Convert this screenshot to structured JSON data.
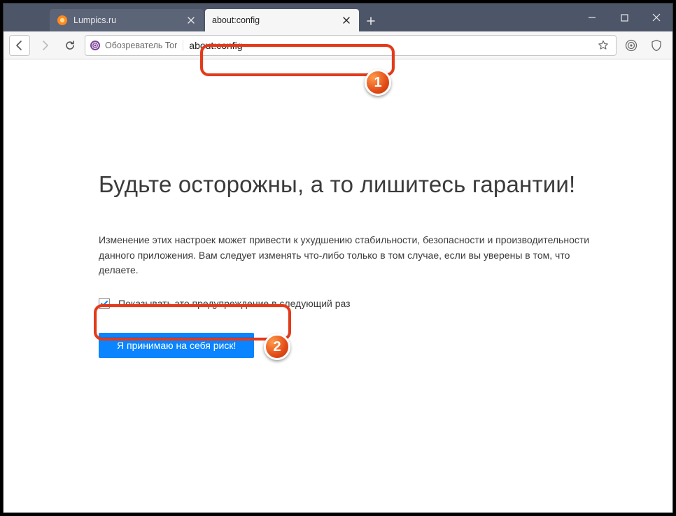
{
  "tabs": [
    {
      "title": "Lumpics.ru",
      "active": false
    },
    {
      "title": "about:config",
      "active": true
    }
  ],
  "identity_label": "Обозреватель Tor",
  "address_value": "about:config",
  "page": {
    "title": "Будьте осторожны, а то лишитесь гарантии!",
    "description": "Изменение этих настроек может привести к ухудшению стабильности, безопасности и производительности данного приложения. Вам следует изменять что-либо только в том случае, если вы уверены в том, что делаете.",
    "checkbox_label": "Показывать это предупреждение в следующий раз",
    "checkbox_checked": true,
    "accept_button": "Я принимаю на себя риск!"
  },
  "annotations": {
    "n1": "1",
    "n2": "2"
  },
  "colors": {
    "accent": "#0a84ff",
    "annotation": "#e43a1a",
    "titlebar": "#4d5568"
  }
}
